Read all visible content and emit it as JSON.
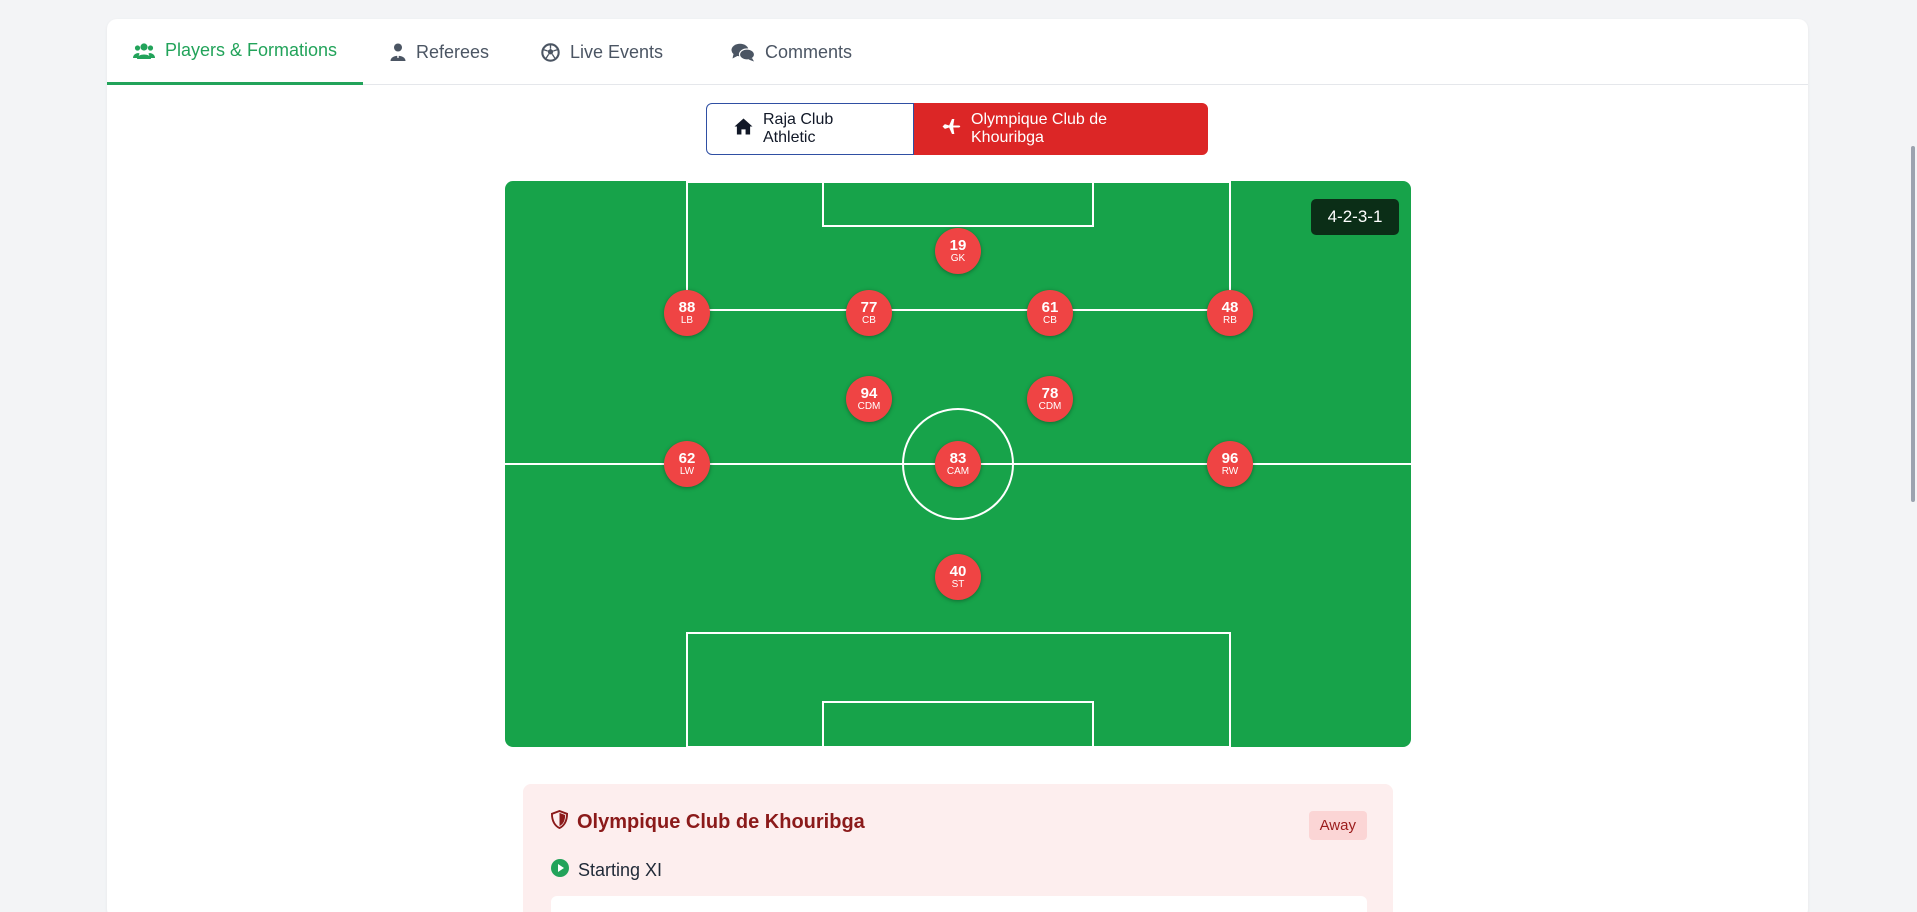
{
  "tabs": [
    {
      "label": "Players & Formations",
      "icon": "users-icon",
      "active": true
    },
    {
      "label": "Referees",
      "icon": "referee-icon",
      "active": false
    },
    {
      "label": "Live Events",
      "icon": "soccer-ball-icon",
      "active": false
    },
    {
      "label": "Comments",
      "icon": "comments-icon",
      "active": false
    }
  ],
  "team_toggle": {
    "home": {
      "label": "Raja Club Athletic",
      "icon": "home-icon"
    },
    "away": {
      "label": "Olympique Club de Khouribga",
      "icon": "plane-icon",
      "selected": true
    }
  },
  "pitch": {
    "formation": "4-2-3-1",
    "players": [
      {
        "number": "19",
        "position": "GK"
      },
      {
        "number": "88",
        "position": "LB"
      },
      {
        "number": "77",
        "position": "CB"
      },
      {
        "number": "61",
        "position": "CB"
      },
      {
        "number": "48",
        "position": "RB"
      },
      {
        "number": "94",
        "position": "CDM"
      },
      {
        "number": "78",
        "position": "CDM"
      },
      {
        "number": "62",
        "position": "LW"
      },
      {
        "number": "83",
        "position": "CAM"
      },
      {
        "number": "96",
        "position": "RW"
      },
      {
        "number": "40",
        "position": "ST"
      }
    ]
  },
  "team_panel": {
    "title": "Olympique Club de Khouribga",
    "badge": "Away",
    "section": "Starting XI"
  },
  "colors": {
    "accent_green": "#22a35a",
    "pitch_green": "#17a34a",
    "away_red": "#dc2626",
    "player_red": "#ef4444",
    "home_border": "#2f4fa3"
  }
}
